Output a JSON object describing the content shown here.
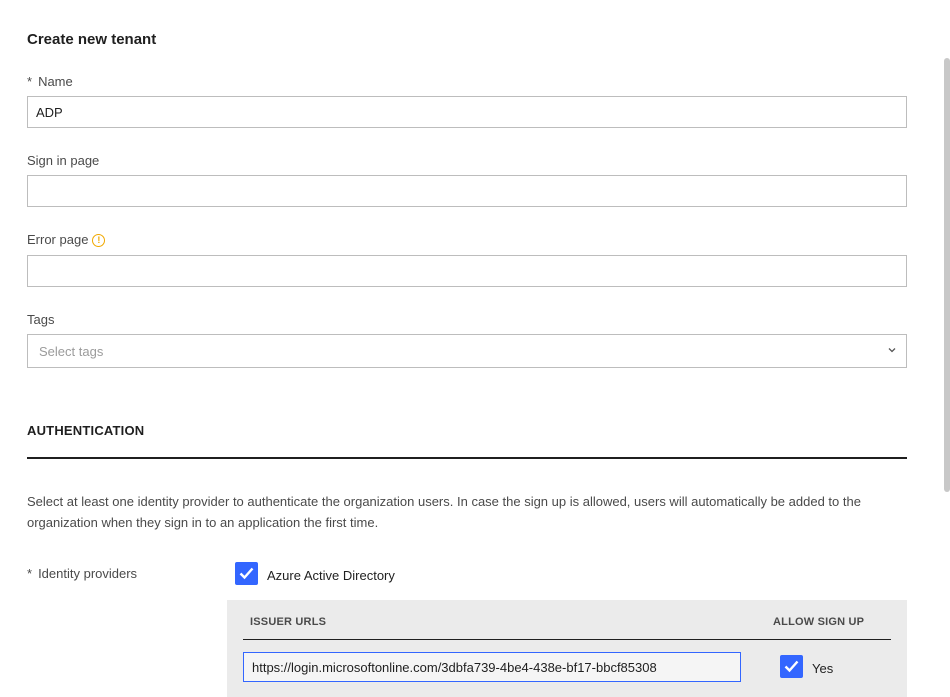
{
  "form": {
    "title": "Create new tenant",
    "required_marker": "*",
    "name": {
      "label": "Name",
      "value": "ADP"
    },
    "sign_in_page": {
      "label": "Sign in page",
      "value": ""
    },
    "error_page": {
      "label": "Error page",
      "value": "",
      "warning_icon": "warning-circle-icon",
      "warning_glyph": "!"
    },
    "tags": {
      "label": "Tags",
      "placeholder": "Select tags"
    }
  },
  "authentication": {
    "heading": "AUTHENTICATION",
    "description": "Select at least one identity provider to authenticate the organization users. In case the sign up is allowed, users will automatically be added to the organization when they sign in to an application the first time.",
    "identity_providers_label": "Identity providers",
    "providers": [
      {
        "label": "Azure Active Directory",
        "checked": true
      }
    ],
    "issuer_table": {
      "col_issuer": "ISSUER URLS",
      "col_allow": "ALLOW SIGN UP",
      "rows": [
        {
          "url": "https://login.microsoftonline.com/3dbfa739-4be4-438e-bf17-bbcf85308",
          "allow_label": "Yes",
          "allow_checked": true
        }
      ]
    }
  },
  "colors": {
    "accent": "#3366ff",
    "warning": "#f0a800"
  }
}
